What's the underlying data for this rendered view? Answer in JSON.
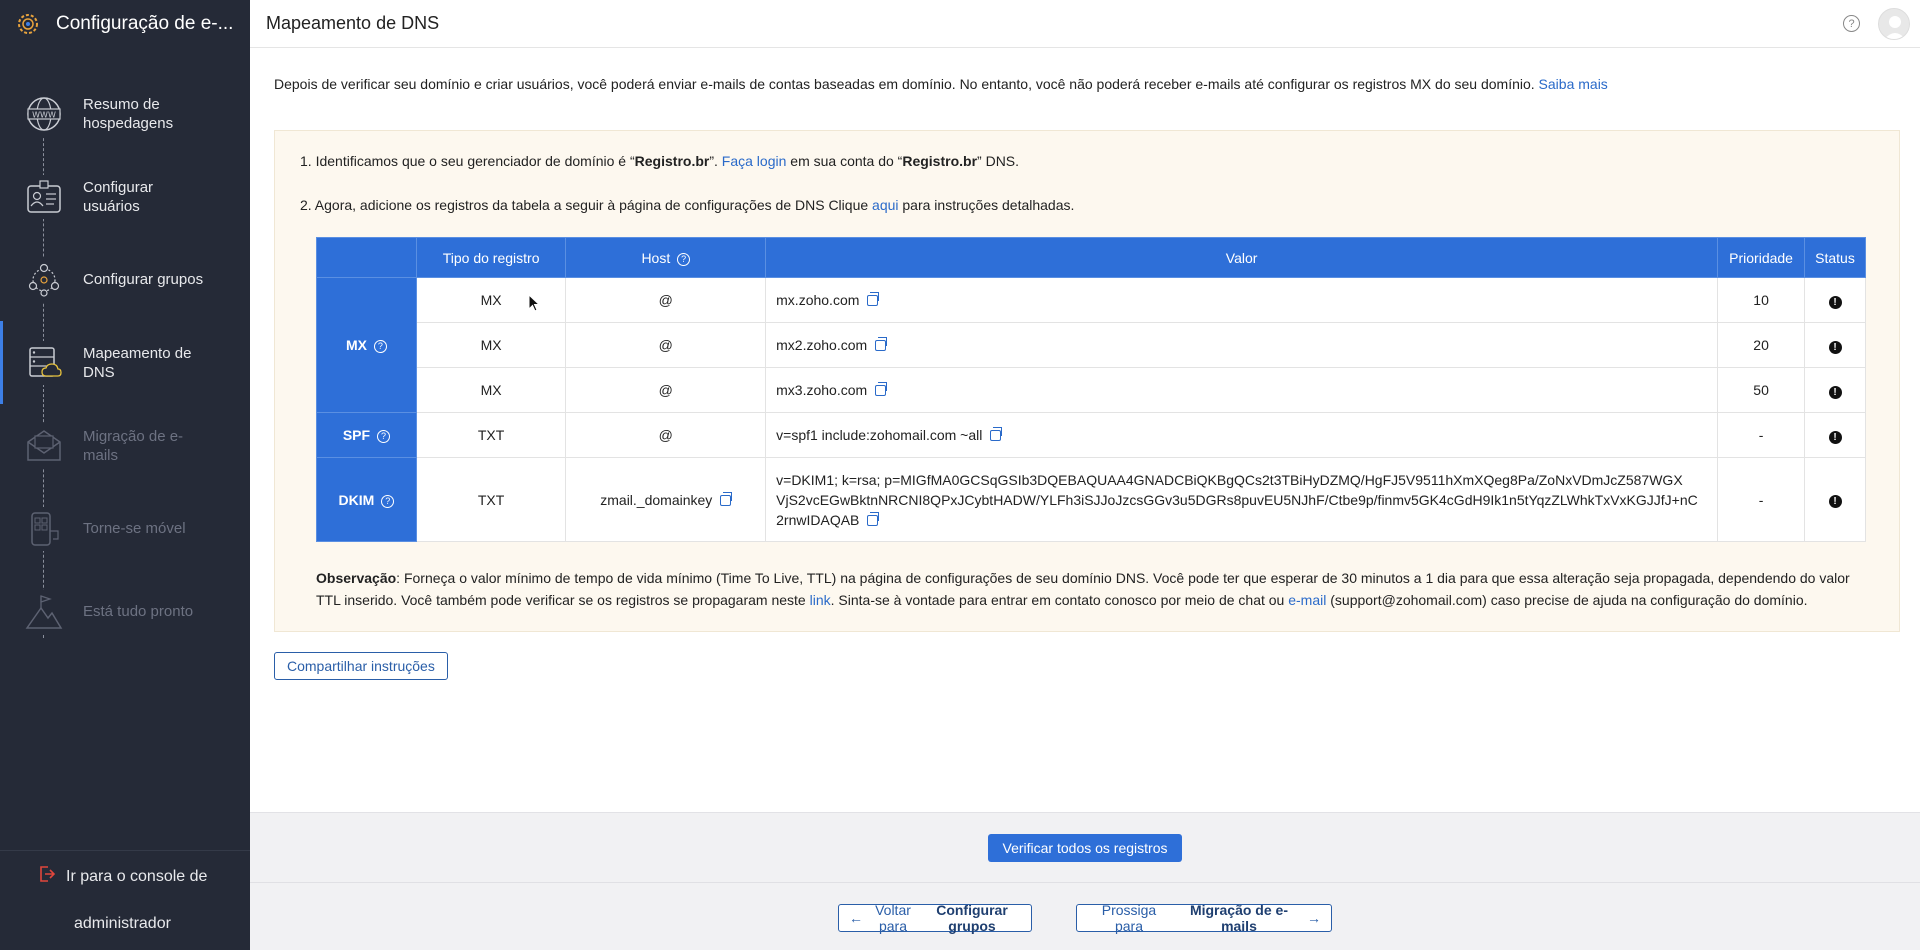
{
  "sidebar": {
    "app_title": "Configuração de e-...",
    "steps": [
      {
        "label": "Resumo de hospedagens",
        "icon": "globe-www-icon",
        "state": "done"
      },
      {
        "label": "Configurar usuários",
        "icon": "user-card-icon",
        "state": "done"
      },
      {
        "label": "Configurar grupos",
        "icon": "group-network-icon",
        "state": "done"
      },
      {
        "label": "Mapeamento de DNS",
        "icon": "dns-server-icon",
        "state": "active"
      },
      {
        "label": "Migração de e-mails",
        "icon": "mail-migration-icon",
        "state": "disabled"
      },
      {
        "label": "Torne-se móvel",
        "icon": "mobile-icon",
        "state": "disabled"
      },
      {
        "label": "Está tudo pronto",
        "icon": "flag-mountain-icon",
        "state": "disabled"
      }
    ],
    "footer_line1": "Ir para o console de",
    "footer_line2": "administrador"
  },
  "header": {
    "title": "Mapeamento de DNS",
    "help_glyph": "?"
  },
  "intro": {
    "text": "Depois de verificar seu domínio e criar usuários, você poderá enviar e-mails de contas baseadas em domínio. No entanto, você não poderá receber e-mails até configurar os registros MX do seu domínio.",
    "link": "Saiba mais"
  },
  "instructions": {
    "step1_prefix": "1. Identificamos que o seu gerenciador de domínio é “",
    "step1_registrar": "Registro.br",
    "step1_mid": "”.",
    "step1_link": "Faça login",
    "step1_mid2": "em sua conta do “",
    "step1_registrar2": "Registro.br",
    "step1_suffix": "” DNS.",
    "step2_prefix": "2. Agora, adicione os registros da tabela a seguir à página de configurações de DNS Clique",
    "step2_link": "aqui",
    "step2_suffix": "para instruções detalhadas."
  },
  "table": {
    "headers": {
      "type": "Tipo do registro",
      "host": "Host",
      "value": "Valor",
      "priority": "Prioridade",
      "status": "Status"
    },
    "group_mx": "MX",
    "group_spf": "SPF",
    "group_dkim": "DKIM",
    "rows": [
      {
        "type": "MX",
        "host": "@",
        "value": "mx.zoho.com",
        "priority": "10"
      },
      {
        "type": "MX",
        "host": "@",
        "value": "mx2.zoho.com",
        "priority": "20"
      },
      {
        "type": "MX",
        "host": "@",
        "value": "mx3.zoho.com",
        "priority": "50"
      },
      {
        "type": "TXT",
        "host": "@",
        "value": "v=spf1 include:zohomail.com ~all",
        "priority": "-"
      },
      {
        "type": "TXT",
        "host": "zmail._domainkey",
        "value_line1": "v=DKIM1; k=rsa; p=MIGfMA0GCSqGSIb3DQEBAQUAA4GNADCBiQKBgQCs2t3TBiHyDZMQ/HgFJ5V9511hXmXQeg8Pa/ZoNxVDmJcZ587WGX",
        "value_line2": "VjS2vcEGwBktnNRCNI8QPxJCybtHADW/YLFh3iSJJoJzcsGGv3u5DGRs8puvEU5NJhF/Ctbe9p/finmv5GK4cGdH9Ik1n5tYqzZLWhkTxVxKGJJfJ+nC",
        "value_line3": "2rnwIDAQAB",
        "priority": "-"
      }
    ],
    "status_glyph": "!"
  },
  "note": {
    "label": "Observação",
    "text1": ": Forneça o valor mínimo de tempo de vida mínimo (Time To Live, TTL) na página de configurações de seu domínio DNS. Você pode ter que esperar de 30 minutos a 1 dia para que essa alteração seja propagada, dependendo do valor TTL inserido. Você também pode verificar se os registros se propagaram neste",
    "link1": "link",
    "text2": ". Sinta-se à vontade para entrar em contato conosco por meio de chat ou",
    "link2": "e-mail",
    "text3": "(support@zohomail.com) caso precise de ajuda na configuração do domínio."
  },
  "buttons": {
    "share": "Compartilhar instruções",
    "verify": "Verificar todos os registros",
    "back_prefix": "Voltar para",
    "back_target": "Configurar grupos",
    "next_prefix": "Prossiga para",
    "next_target": "Migração de e-mails"
  },
  "colors": {
    "sidebar_bg": "#252a37",
    "accent": "#2e6fd8",
    "panel_bg": "#fdf8ef",
    "link": "#2a6ac9"
  }
}
